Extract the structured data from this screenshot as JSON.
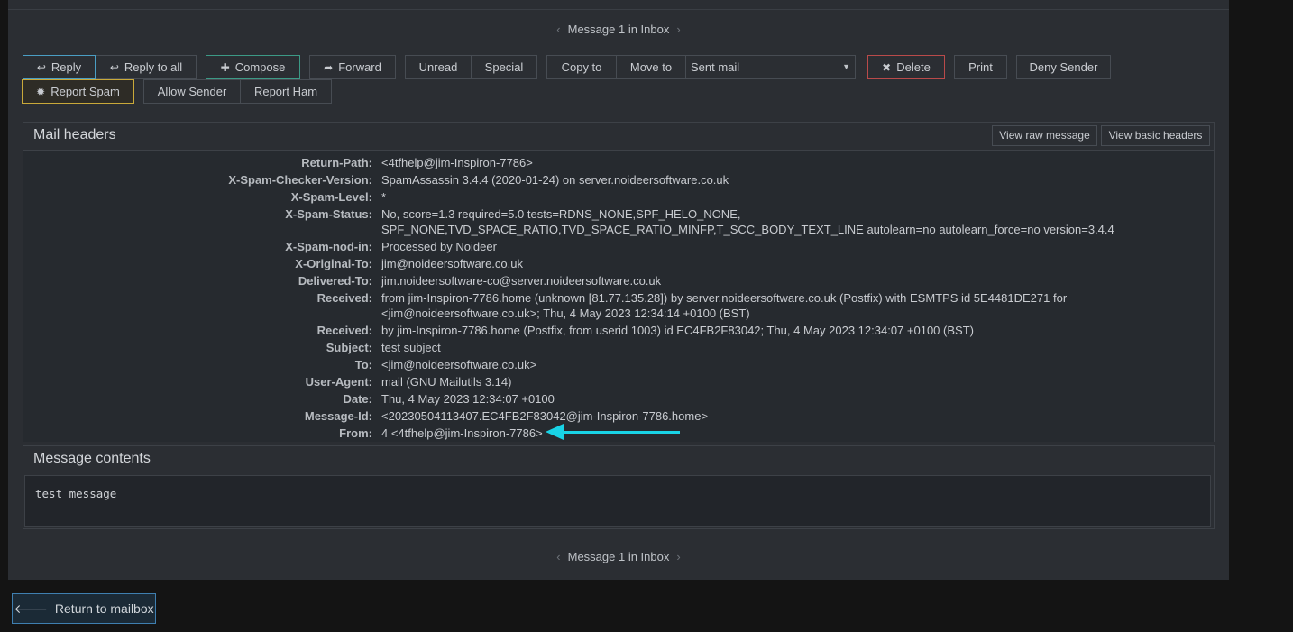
{
  "pager": {
    "top_label": "Message 1 in Inbox",
    "bottom_label": "Message 1 in Inbox",
    "prev_glyph": "‹",
    "next_glyph": "›"
  },
  "toolbar": {
    "reply": "Reply",
    "reply_all": "Reply to all",
    "compose": "Compose",
    "forward": "Forward",
    "unread": "Unread",
    "special": "Special",
    "copy_to": "Copy to",
    "move_to": "Move to",
    "folder_select": "Sent mail",
    "delete": "Delete",
    "print": "Print",
    "deny_sender": "Deny Sender",
    "report_spam": "Report Spam",
    "allow_sender": "Allow Sender",
    "report_ham": "Report Ham"
  },
  "mail_headers": {
    "title": "Mail headers",
    "view_raw": "View raw message",
    "view_basic": "View basic headers",
    "rows": [
      {
        "key": "Return-Path:",
        "value": "<4tfhelp@jim-Inspiron-7786>"
      },
      {
        "key": "X-Spam-Checker-Version:",
        "value": "SpamAssassin 3.4.4 (2020-01-24) on server.noideersoftware.co.uk"
      },
      {
        "key": "X-Spam-Level:",
        "value": "*"
      },
      {
        "key": "X-Spam-Status:",
        "value": "No, score=1.3 required=5.0 tests=RDNS_NONE,SPF_HELO_NONE, SPF_NONE,TVD_SPACE_RATIO,TVD_SPACE_RATIO_MINFP,T_SCC_BODY_TEXT_LINE autolearn=no autolearn_force=no version=3.4.4"
      },
      {
        "key": "X-Spam-nod-in:",
        "value": "Processed by Noideer"
      },
      {
        "key": "X-Original-To:",
        "value": "jim@noideersoftware.co.uk"
      },
      {
        "key": "Delivered-To:",
        "value": "jim.noideersoftware-co@server.noideersoftware.co.uk"
      },
      {
        "key": "Received:",
        "value": "from jim-Inspiron-7786.home (unknown [81.77.135.28]) by server.noideersoftware.co.uk (Postfix) with ESMTPS id 5E4481DE271 for <jim@noideersoftware.co.uk>; Thu, 4 May 2023 12:34:14 +0100 (BST)"
      },
      {
        "key": "Received:",
        "value": "by jim-Inspiron-7786.home (Postfix, from userid 1003) id EC4FB2F83042; Thu, 4 May 2023 12:34:07 +0100 (BST)"
      },
      {
        "key": "Subject:",
        "value": "test subject"
      },
      {
        "key": "To:",
        "value": "<jim@noideersoftware.co.uk>"
      },
      {
        "key": "User-Agent:",
        "value": "mail (GNU Mailutils 3.14)"
      },
      {
        "key": "Date:",
        "value": "Thu, 4 May 2023 12:34:07 +0100"
      },
      {
        "key": "Message-Id:",
        "value": "<20230504113407.EC4FB2F83042@jim-Inspiron-7786.home>"
      },
      {
        "key": "From:",
        "value": "4 <4tfhelp@jim-Inspiron-7786>"
      }
    ]
  },
  "message_contents": {
    "title": "Message contents",
    "body": "test message"
  },
  "return_button": "Return to mailbox",
  "colors": {
    "panel": "#2b2e33",
    "annotation_arrow": "#19d3e6",
    "delete_border": "#b94a4a",
    "compose_border": "#3c9a86",
    "reply_border": "#4a9ec4",
    "spam_border": "#c9a93a"
  }
}
